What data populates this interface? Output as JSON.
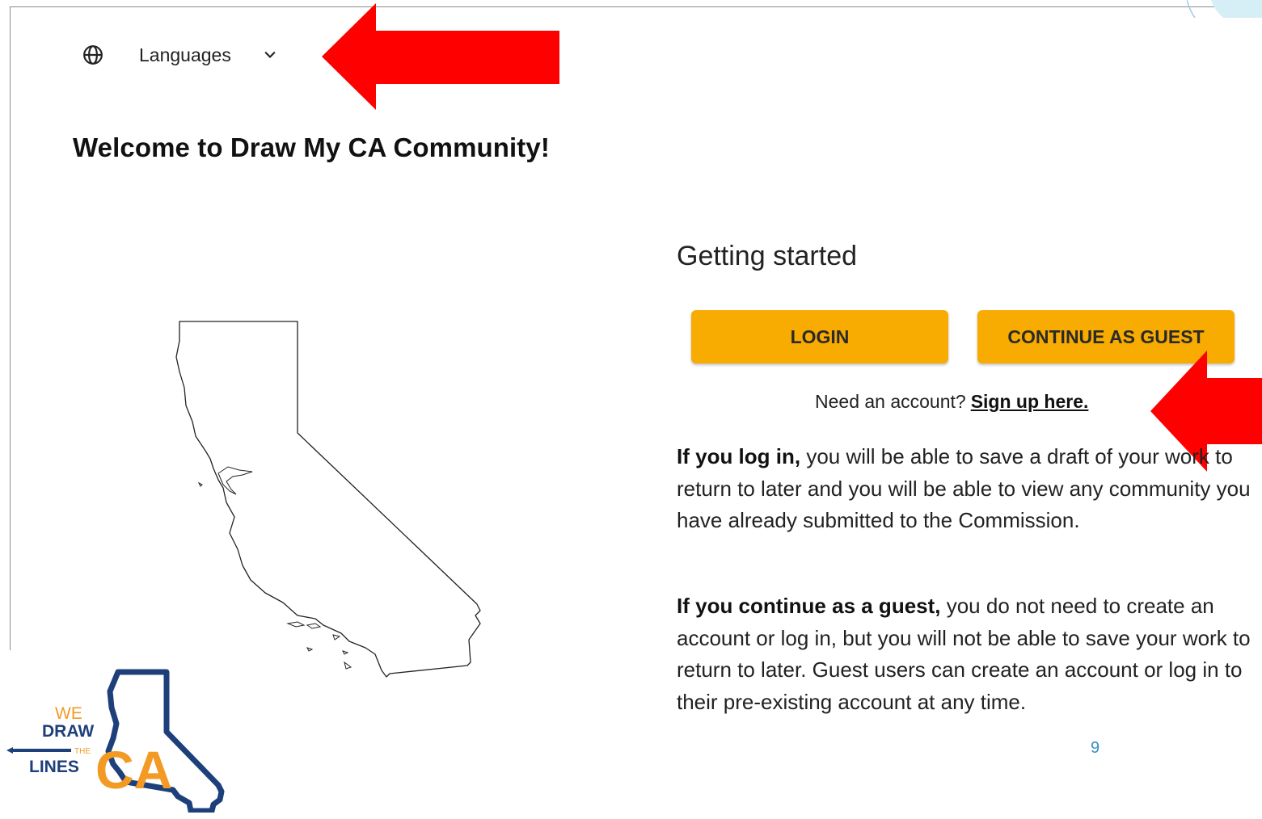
{
  "languages": {
    "label": "Languages",
    "icon": "globe-icon",
    "chevron": "chevron-down-icon"
  },
  "welcome": {
    "title": "Welcome to Draw My CA Community!"
  },
  "getting_started": {
    "heading": "Getting started",
    "login_label": "LOGIN",
    "guest_label": "CONTINUE AS GUEST",
    "need_account_text": "Need an account?",
    "signup_link": "Sign up here."
  },
  "info": {
    "login_lead": "If you log in,",
    "login_text": " you will be able to save a draft of your work to return to later and you will be able to view any community you have already submitted to the Commission.",
    "guest_lead": "If you continue as a guest,",
    "guest_text": " you do not need to create an account or log in, but you will not be able to save your work to return to later. Guest users can create an account or log in to their pre-existing account at any time."
  },
  "page_number": "9",
  "logo": {
    "we": "WE",
    "draw": "DRAW",
    "the": "THE",
    "lines": "LINES",
    "ca": "CA"
  },
  "colors": {
    "button": "#f8ab00",
    "arrow": "#ff0000",
    "logo_orange": "#f39a24",
    "logo_blue": "#1d3f7a",
    "page_number": "#3a8fc0"
  }
}
